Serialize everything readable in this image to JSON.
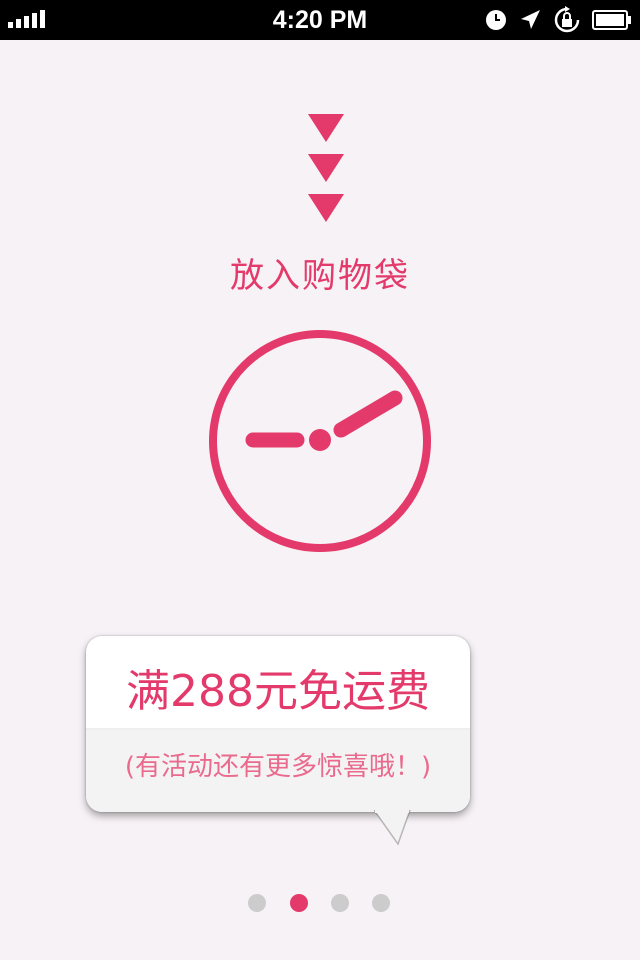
{
  "status_bar": {
    "time": "4:20 PM",
    "icons": [
      "signal-bars-icon",
      "clock-icon",
      "location-arrow-icon",
      "rotation-lock-icon",
      "battery-icon"
    ]
  },
  "page": {
    "title": "放入购物袋",
    "decoration_icons": [
      "down-arrows-icon",
      "clock-face-icon"
    ]
  },
  "promo": {
    "headline": "满288元免运费",
    "subtext": "(有活动还有更多惊喜哦！)"
  },
  "pager": {
    "count": 4,
    "active_index": 1
  },
  "colors": {
    "accent": "#e33a6b",
    "accent_light": "#ea6a8e",
    "background": "#f7f2f6",
    "inactive_dot": "#cccccc"
  }
}
